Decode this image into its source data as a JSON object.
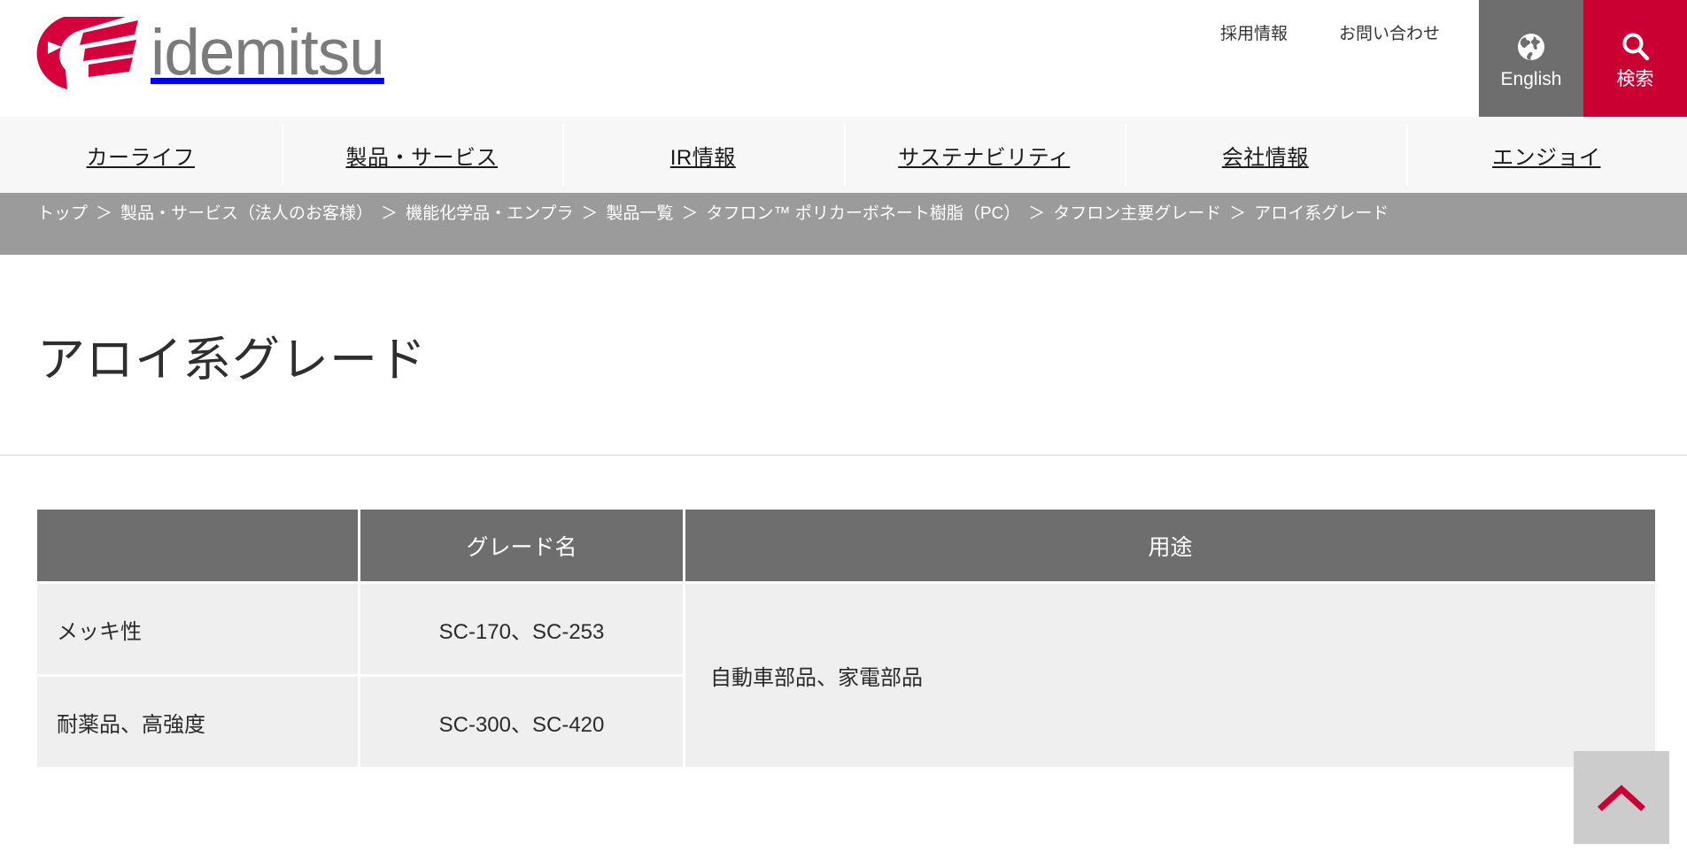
{
  "header": {
    "logo_text": "idemitsu",
    "logo_icon": "idemitsu-flag-logo",
    "util_links": [
      {
        "label": "採用情報",
        "name": "recruit-link"
      },
      {
        "label": "お問い合わせ",
        "name": "contact-link"
      }
    ],
    "language_button": {
      "label": "English",
      "icon": "globe-icon",
      "bg": "#6e6e6e"
    },
    "search_button": {
      "label": "検索",
      "icon": "search-icon",
      "bg": "#ca0032"
    }
  },
  "nav": {
    "items": [
      {
        "label": "カーライフ"
      },
      {
        "label": "製品・サービス"
      },
      {
        "label": "IR情報"
      },
      {
        "label": "サステナビリティ"
      },
      {
        "label": "会社情報"
      },
      {
        "label": "エンジョイ"
      }
    ]
  },
  "breadcrumb": {
    "separator": "＞",
    "items": [
      "トップ",
      "製品・サービス（法人のお客様）",
      "機能化学品・エンプラ",
      "製品一覧",
      "タフロン™ ポリカーボネート樹脂（PC）",
      "タフロン主要グレード",
      "アロイ系グレード"
    ]
  },
  "page": {
    "title": "アロイ系グレード"
  },
  "table": {
    "headers": [
      "",
      "グレード名",
      "用途"
    ],
    "rows": [
      {
        "category": "メッキ性",
        "grade": "SC-170、SC-253"
      },
      {
        "category": "耐薬品、高強度",
        "grade": "SC-300、SC-420"
      }
    ],
    "use_merged": "自動車部品、家電部品"
  },
  "pagetop": {
    "icon": "chevron-up-icon",
    "accent": "#ca0032"
  }
}
